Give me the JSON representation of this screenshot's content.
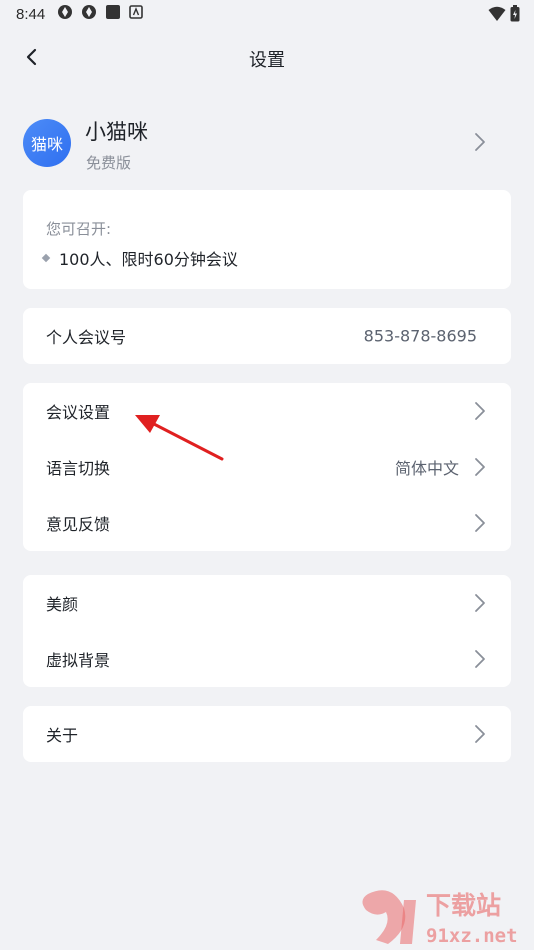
{
  "status_bar": {
    "time": "8:44"
  },
  "nav": {
    "title": "设置"
  },
  "profile": {
    "avatar_text": "猫咪",
    "name": "小猫咪",
    "plan": "免费版"
  },
  "capacity": {
    "title": "您可召开:",
    "item": "100人、限时60分钟会议"
  },
  "personal_meeting": {
    "label": "个人会议号",
    "value": "853-878-8695"
  },
  "group1": [
    {
      "label": "会议设置",
      "value": ""
    },
    {
      "label": "语言切换",
      "value": "简体中文"
    },
    {
      "label": "意见反馈",
      "value": ""
    }
  ],
  "group2": [
    {
      "label": "美颜"
    },
    {
      "label": "虚拟背景"
    }
  ],
  "group3": [
    {
      "label": "关于"
    }
  ],
  "watermark": {
    "brand": "下载站",
    "domain": "91xz.net"
  },
  "colors": {
    "accent": "#2f6ff0",
    "annotation": "#e02020",
    "background": "#f1f2f5"
  }
}
